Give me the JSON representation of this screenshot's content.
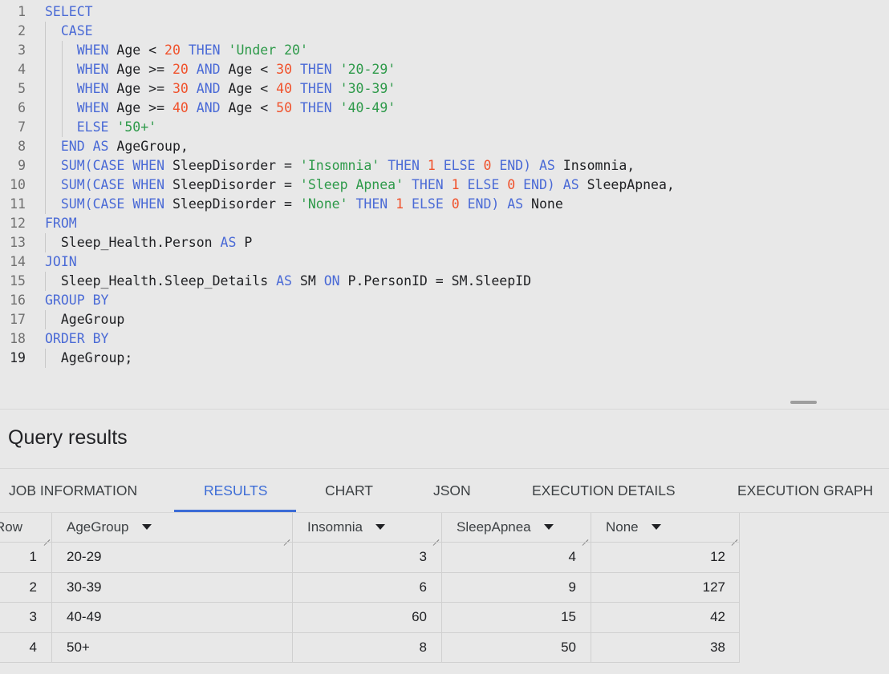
{
  "editor": {
    "lines": [
      {
        "n": "1",
        "tokens": [
          {
            "t": "kw",
            "v": "SELECT"
          }
        ]
      },
      {
        "n": "2",
        "tokens": [
          {
            "t": "",
            "v": "  "
          },
          {
            "t": "kw",
            "v": "CASE"
          }
        ]
      },
      {
        "n": "3",
        "tokens": [
          {
            "t": "",
            "v": "    "
          },
          {
            "t": "kw",
            "v": "WHEN"
          },
          {
            "t": "",
            "v": " Age < "
          },
          {
            "t": "num",
            "v": "20"
          },
          {
            "t": "",
            "v": " "
          },
          {
            "t": "kw",
            "v": "THEN"
          },
          {
            "t": "",
            "v": " "
          },
          {
            "t": "str",
            "v": "'Under 20'"
          }
        ]
      },
      {
        "n": "4",
        "tokens": [
          {
            "t": "",
            "v": "    "
          },
          {
            "t": "kw",
            "v": "WHEN"
          },
          {
            "t": "",
            "v": " Age >= "
          },
          {
            "t": "num",
            "v": "20"
          },
          {
            "t": "",
            "v": " "
          },
          {
            "t": "kw",
            "v": "AND"
          },
          {
            "t": "",
            "v": " Age < "
          },
          {
            "t": "num",
            "v": "30"
          },
          {
            "t": "",
            "v": " "
          },
          {
            "t": "kw",
            "v": "THEN"
          },
          {
            "t": "",
            "v": " "
          },
          {
            "t": "str",
            "v": "'20-29'"
          }
        ]
      },
      {
        "n": "5",
        "tokens": [
          {
            "t": "",
            "v": "    "
          },
          {
            "t": "kw",
            "v": "WHEN"
          },
          {
            "t": "",
            "v": " Age >= "
          },
          {
            "t": "num",
            "v": "30"
          },
          {
            "t": "",
            "v": " "
          },
          {
            "t": "kw",
            "v": "AND"
          },
          {
            "t": "",
            "v": " Age < "
          },
          {
            "t": "num",
            "v": "40"
          },
          {
            "t": "",
            "v": " "
          },
          {
            "t": "kw",
            "v": "THEN"
          },
          {
            "t": "",
            "v": " "
          },
          {
            "t": "str",
            "v": "'30-39'"
          }
        ]
      },
      {
        "n": "6",
        "tokens": [
          {
            "t": "",
            "v": "    "
          },
          {
            "t": "kw",
            "v": "WHEN"
          },
          {
            "t": "",
            "v": " Age >= "
          },
          {
            "t": "num",
            "v": "40"
          },
          {
            "t": "",
            "v": " "
          },
          {
            "t": "kw",
            "v": "AND"
          },
          {
            "t": "",
            "v": " Age < "
          },
          {
            "t": "num",
            "v": "50"
          },
          {
            "t": "",
            "v": " "
          },
          {
            "t": "kw",
            "v": "THEN"
          },
          {
            "t": "",
            "v": " "
          },
          {
            "t": "str",
            "v": "'40-49'"
          }
        ]
      },
      {
        "n": "7",
        "tokens": [
          {
            "t": "",
            "v": "    "
          },
          {
            "t": "kw",
            "v": "ELSE"
          },
          {
            "t": "",
            "v": " "
          },
          {
            "t": "str",
            "v": "'50+'"
          }
        ]
      },
      {
        "n": "8",
        "tokens": [
          {
            "t": "",
            "v": "  "
          },
          {
            "t": "kw",
            "v": "END AS"
          },
          {
            "t": "",
            "v": " AgeGroup,"
          }
        ]
      },
      {
        "n": "9",
        "tokens": [
          {
            "t": "",
            "v": "  "
          },
          {
            "t": "kw",
            "v": "SUM(CASE WHEN"
          },
          {
            "t": "",
            "v": " SleepDisorder = "
          },
          {
            "t": "str",
            "v": "'Insomnia'"
          },
          {
            "t": "",
            "v": " "
          },
          {
            "t": "kw",
            "v": "THEN"
          },
          {
            "t": "",
            "v": " "
          },
          {
            "t": "num",
            "v": "1"
          },
          {
            "t": "",
            "v": " "
          },
          {
            "t": "kw",
            "v": "ELSE"
          },
          {
            "t": "",
            "v": " "
          },
          {
            "t": "num",
            "v": "0"
          },
          {
            "t": "",
            "v": " "
          },
          {
            "t": "kw",
            "v": "END) AS"
          },
          {
            "t": "",
            "v": " Insomnia,"
          }
        ]
      },
      {
        "n": "10",
        "tokens": [
          {
            "t": "",
            "v": "  "
          },
          {
            "t": "kw",
            "v": "SUM(CASE WHEN"
          },
          {
            "t": "",
            "v": " SleepDisorder = "
          },
          {
            "t": "str",
            "v": "'Sleep Apnea'"
          },
          {
            "t": "",
            "v": " "
          },
          {
            "t": "kw",
            "v": "THEN"
          },
          {
            "t": "",
            "v": " "
          },
          {
            "t": "num",
            "v": "1"
          },
          {
            "t": "",
            "v": " "
          },
          {
            "t": "kw",
            "v": "ELSE"
          },
          {
            "t": "",
            "v": " "
          },
          {
            "t": "num",
            "v": "0"
          },
          {
            "t": "",
            "v": " "
          },
          {
            "t": "kw",
            "v": "END) AS"
          },
          {
            "t": "",
            "v": " SleepApnea,"
          }
        ]
      },
      {
        "n": "11",
        "tokens": [
          {
            "t": "",
            "v": "  "
          },
          {
            "t": "kw",
            "v": "SUM(CASE WHEN"
          },
          {
            "t": "",
            "v": " SleepDisorder = "
          },
          {
            "t": "str",
            "v": "'None'"
          },
          {
            "t": "",
            "v": " "
          },
          {
            "t": "kw",
            "v": "THEN"
          },
          {
            "t": "",
            "v": " "
          },
          {
            "t": "num",
            "v": "1"
          },
          {
            "t": "",
            "v": " "
          },
          {
            "t": "kw",
            "v": "ELSE"
          },
          {
            "t": "",
            "v": " "
          },
          {
            "t": "num",
            "v": "0"
          },
          {
            "t": "",
            "v": " "
          },
          {
            "t": "kw",
            "v": "END) AS"
          },
          {
            "t": "",
            "v": " None"
          }
        ]
      },
      {
        "n": "12",
        "tokens": [
          {
            "t": "kw",
            "v": "FROM"
          }
        ]
      },
      {
        "n": "13",
        "tokens": [
          {
            "t": "",
            "v": "  Sleep_Health.Person "
          },
          {
            "t": "kw",
            "v": "AS"
          },
          {
            "t": "",
            "v": " P"
          }
        ]
      },
      {
        "n": "14",
        "tokens": [
          {
            "t": "kw",
            "v": "JOIN"
          }
        ]
      },
      {
        "n": "15",
        "tokens": [
          {
            "t": "",
            "v": "  Sleep_Health.Sleep_Details "
          },
          {
            "t": "kw",
            "v": "AS"
          },
          {
            "t": "",
            "v": " SM "
          },
          {
            "t": "kw",
            "v": "ON"
          },
          {
            "t": "",
            "v": " P.PersonID = SM.SleepID"
          }
        ]
      },
      {
        "n": "16",
        "tokens": [
          {
            "t": "kw",
            "v": "GROUP BY"
          }
        ]
      },
      {
        "n": "17",
        "tokens": [
          {
            "t": "",
            "v": "  AgeGroup"
          }
        ]
      },
      {
        "n": "18",
        "tokens": [
          {
            "t": "kw",
            "v": "ORDER BY"
          }
        ]
      },
      {
        "n": "19",
        "tokens": [
          {
            "t": "",
            "v": "  AgeGroup;"
          }
        ]
      }
    ]
  },
  "results": {
    "title": "Query results",
    "tabs": [
      "JOB INFORMATION",
      "RESULTS",
      "CHART",
      "JSON",
      "EXECUTION DETAILS",
      "EXECUTION GRAPH"
    ],
    "active_tab": "RESULTS",
    "columns": [
      "Row",
      "AgeGroup",
      "Insomnia",
      "SleepApnea",
      "None"
    ],
    "rows": [
      [
        "1",
        "20-29",
        "3",
        "4",
        "12"
      ],
      [
        "2",
        "30-39",
        "6",
        "9",
        "127"
      ],
      [
        "3",
        "40-49",
        "60",
        "15",
        "42"
      ],
      [
        "4",
        "50+",
        "8",
        "50",
        "38"
      ]
    ]
  },
  "colors": {
    "keyword": "#4a6ad6",
    "number": "#f0522c",
    "string": "#2e9a4a",
    "accent": "#3c6cd6"
  }
}
